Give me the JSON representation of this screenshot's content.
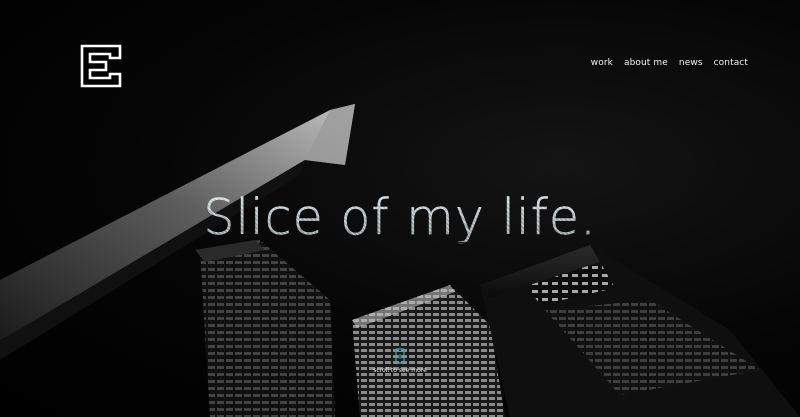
{
  "nav": {
    "items": [
      {
        "label": "work"
      },
      {
        "label": "about me"
      },
      {
        "label": "news"
      },
      {
        "label": "contact"
      }
    ]
  },
  "hero": {
    "headline": "Slice of my life.",
    "scroll_hint": "scroll to see more"
  },
  "icons": {
    "logo": "letter-e-logo-icon",
    "scroll": "phone-scroll-icon"
  },
  "colors": {
    "background": "#000000",
    "nav_text": "#f2f2f2",
    "scroll_accent": "#3fa9b8"
  }
}
